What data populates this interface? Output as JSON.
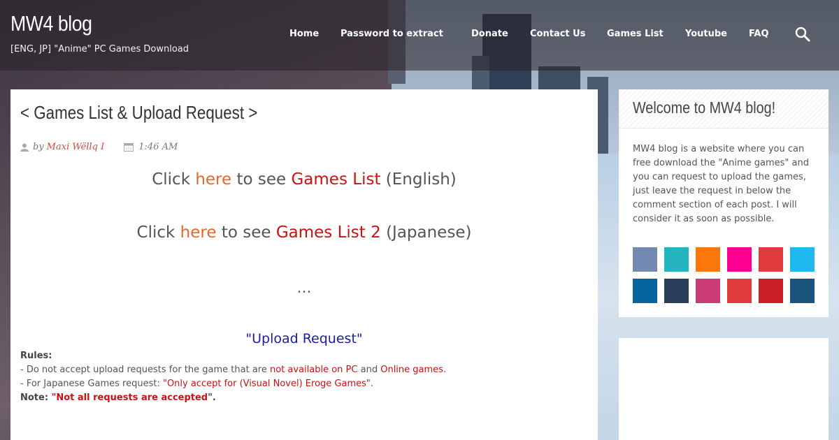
{
  "site": {
    "title": "MW4 blog",
    "description": "[ENG, JP] \"Anime\" PC Games Download"
  },
  "nav": {
    "items": [
      "Home",
      "Password to extract",
      "Donate",
      "Contact Us",
      "Games List",
      "Youtube",
      "FAQ"
    ],
    "search_icon": "search-icon"
  },
  "post": {
    "title": "< Games List & Upload Request >",
    "meta": {
      "by": "by",
      "author": "Maxi Wëllq I",
      "time": "1:46 AM"
    },
    "line1": {
      "click": "Click",
      "here": "here",
      "to_see": "to see",
      "link": "Games List",
      "lang": "(English)"
    },
    "line2": {
      "click": "Click",
      "here": "here",
      "to_see": "to see",
      "link": "Games List 2",
      "lang": "(Japanese)"
    },
    "dots": "...",
    "upload_title": "\"Upload Request\"",
    "rules": {
      "heading": "Rules:",
      "r1_a": "- Do not accept upload requests for the game that are ",
      "r1_b": "not available on PC",
      "r1_c": " and ",
      "r1_d": "Online games",
      "r1_e": ".",
      "r2_a": "- For Japanese Games request: ",
      "r2_b": "\"Only accept for (Visual Novel) Eroge Games\"",
      "r2_c": ".",
      "note_label": "Note: ",
      "note_q1": "\"",
      "note_text": "Not all requests are accepted",
      "note_q2": "\"."
    }
  },
  "sidebar": {
    "widget_title": "Welcome to MW4 blog!",
    "widget_text": "MW4 blog is a website where you can free download the \"Anime games\" and you can request to upload the games, just leave the request in below the comment section of each post. I will consider it as soon as possible.",
    "social_colors": [
      "#7389b3",
      "#23b4c0",
      "#fb7709",
      "#ff0092",
      "#e13b3b",
      "#1eb9ee",
      "#04659f",
      "#2b3f5b",
      "#cc3a73",
      "#e13b3b",
      "#cb2027",
      "#1b557d"
    ]
  },
  "colors": {
    "accent_orange": "#e8662e",
    "accent_red": "#cc1111",
    "link_blue": "#1a1ab0"
  }
}
